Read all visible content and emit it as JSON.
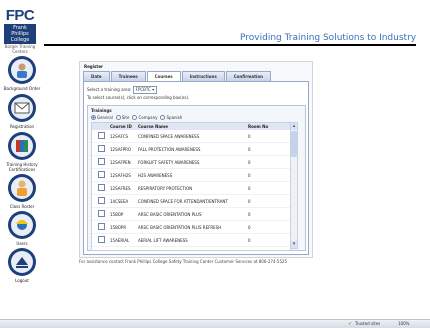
{
  "logo": {
    "name": "FPC",
    "line1": "Frank Phillips",
    "line2": "College",
    "tag": "Borger Training Centers"
  },
  "header": {
    "title": "Providing Training Solutions to Industry"
  },
  "nav": [
    {
      "label": "Background Order",
      "icon": "person-icon"
    },
    {
      "label": "Registration",
      "icon": "envelope-icon"
    },
    {
      "label": "Training History Certifications",
      "icon": "books-icon"
    },
    {
      "label": "Class Roster",
      "icon": "person-icon"
    },
    {
      "label": "Users",
      "icon": "hard-hat-icon"
    },
    {
      "label": "Logout",
      "icon": "logout-icon"
    }
  ],
  "panel": {
    "title": "Register",
    "tabs": [
      "Date",
      "Trainees",
      "Courses",
      "Instructions",
      "Confirmation"
    ],
    "active_tab": "Courses",
    "training_area_label": "Select a training area:",
    "training_area_value": "FPCBTC",
    "instructions": "To select course(s), click on corresponding box(es).",
    "trainings_label": "Trainings",
    "radios": [
      {
        "label": "General",
        "selected": true
      },
      {
        "label": "Site",
        "selected": false
      },
      {
        "label": "Company",
        "selected": false
      },
      {
        "label": "Spanish",
        "selected": false
      }
    ],
    "columns": [
      "Course ID",
      "Course Name",
      "Room No"
    ],
    "rows": [
      {
        "id": "12SAFCS",
        "name": "CONFINED SPACE AWARENESS",
        "room": "0"
      },
      {
        "id": "12SAFPRO",
        "name": "FALL PROTECTION AWARENESS",
        "room": "0"
      },
      {
        "id": "12SAFPEN",
        "name": "FORKLIFT SAFETY AWARENESS",
        "room": "0"
      },
      {
        "id": "12SAFH2S",
        "name": "H2S AWARENESS",
        "room": "0"
      },
      {
        "id": "12SAFRES",
        "name": "RESPIRATORY PROTECTION",
        "room": "0"
      },
      {
        "id": "14CSEEA",
        "name": "CONFINED SPACE FOR ATTENDANT/ENTRANT",
        "room": "0"
      },
      {
        "id": "15BOP",
        "name": "ARSC BASIC ORIENTATION PLUS",
        "room": "0"
      },
      {
        "id": "15BOPR",
        "name": "ARSC BASIC ORIENTATION PLUS REFRESH",
        "room": "0"
      },
      {
        "id": "15AERIAL",
        "name": "AERIAL LIFT AWARENESS",
        "room": "0"
      }
    ]
  },
  "footer": {
    "text": "For assistance contact Frank Phillips College Safety Training Center Customer Services at 806-274-5525"
  },
  "statusbar": {
    "zone": "Trusted sites",
    "zoom": "100%"
  }
}
